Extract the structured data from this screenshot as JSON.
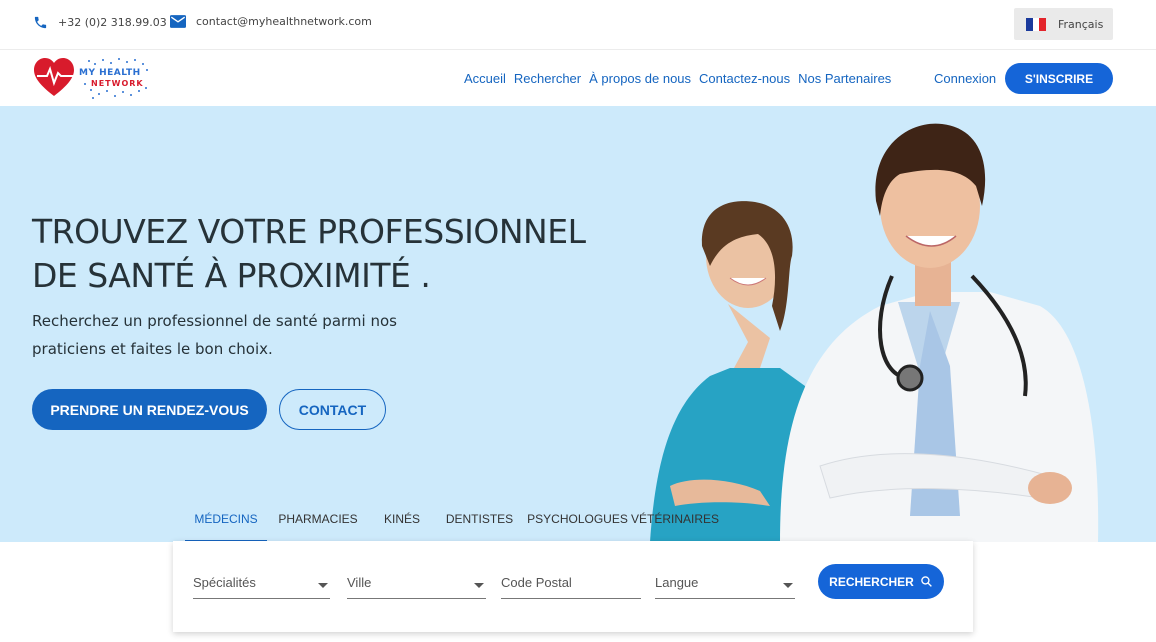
{
  "topbar": {
    "phone": "+32 (0)2 318.99.03",
    "email": "contact@myhealthnetwork.com",
    "language": "Français"
  },
  "logo": {
    "line1": "MY HEALTH",
    "line2": "NETWORK"
  },
  "nav": {
    "links": [
      "Accueil",
      "Rechercher",
      "À propos de nous",
      "Contactez-nous",
      "Nos Partenaires"
    ],
    "login": "Connexion",
    "signup": "S'INSCRIRE"
  },
  "hero": {
    "title_line1": "TROUVEZ VOTRE PROFESSIONNEL",
    "title_line2": "DE SANTÉ À PROXIMITÉ .",
    "subtitle": "Recherchez un professionnel de santé parmi nos praticiens et faites le bon choix.",
    "primary_button": "PRENDRE UN RENDEZ-VOUS",
    "secondary_button": "CONTACT"
  },
  "tabs": [
    "MÉDECINS",
    "PHARMACIES",
    "KINÉS",
    "DENTISTES",
    "PSYCHOLOGUES",
    "VÉTÉRINAIRES"
  ],
  "search": {
    "specialites": "Spécialités",
    "ville": "Ville",
    "code_postal": "Code Postal",
    "langue": "Langue",
    "button": "RECHERCHER"
  },
  "colors": {
    "primary": "#1565c0",
    "hero_bg": "#cdeafb",
    "logo_red": "#d81b2c"
  }
}
